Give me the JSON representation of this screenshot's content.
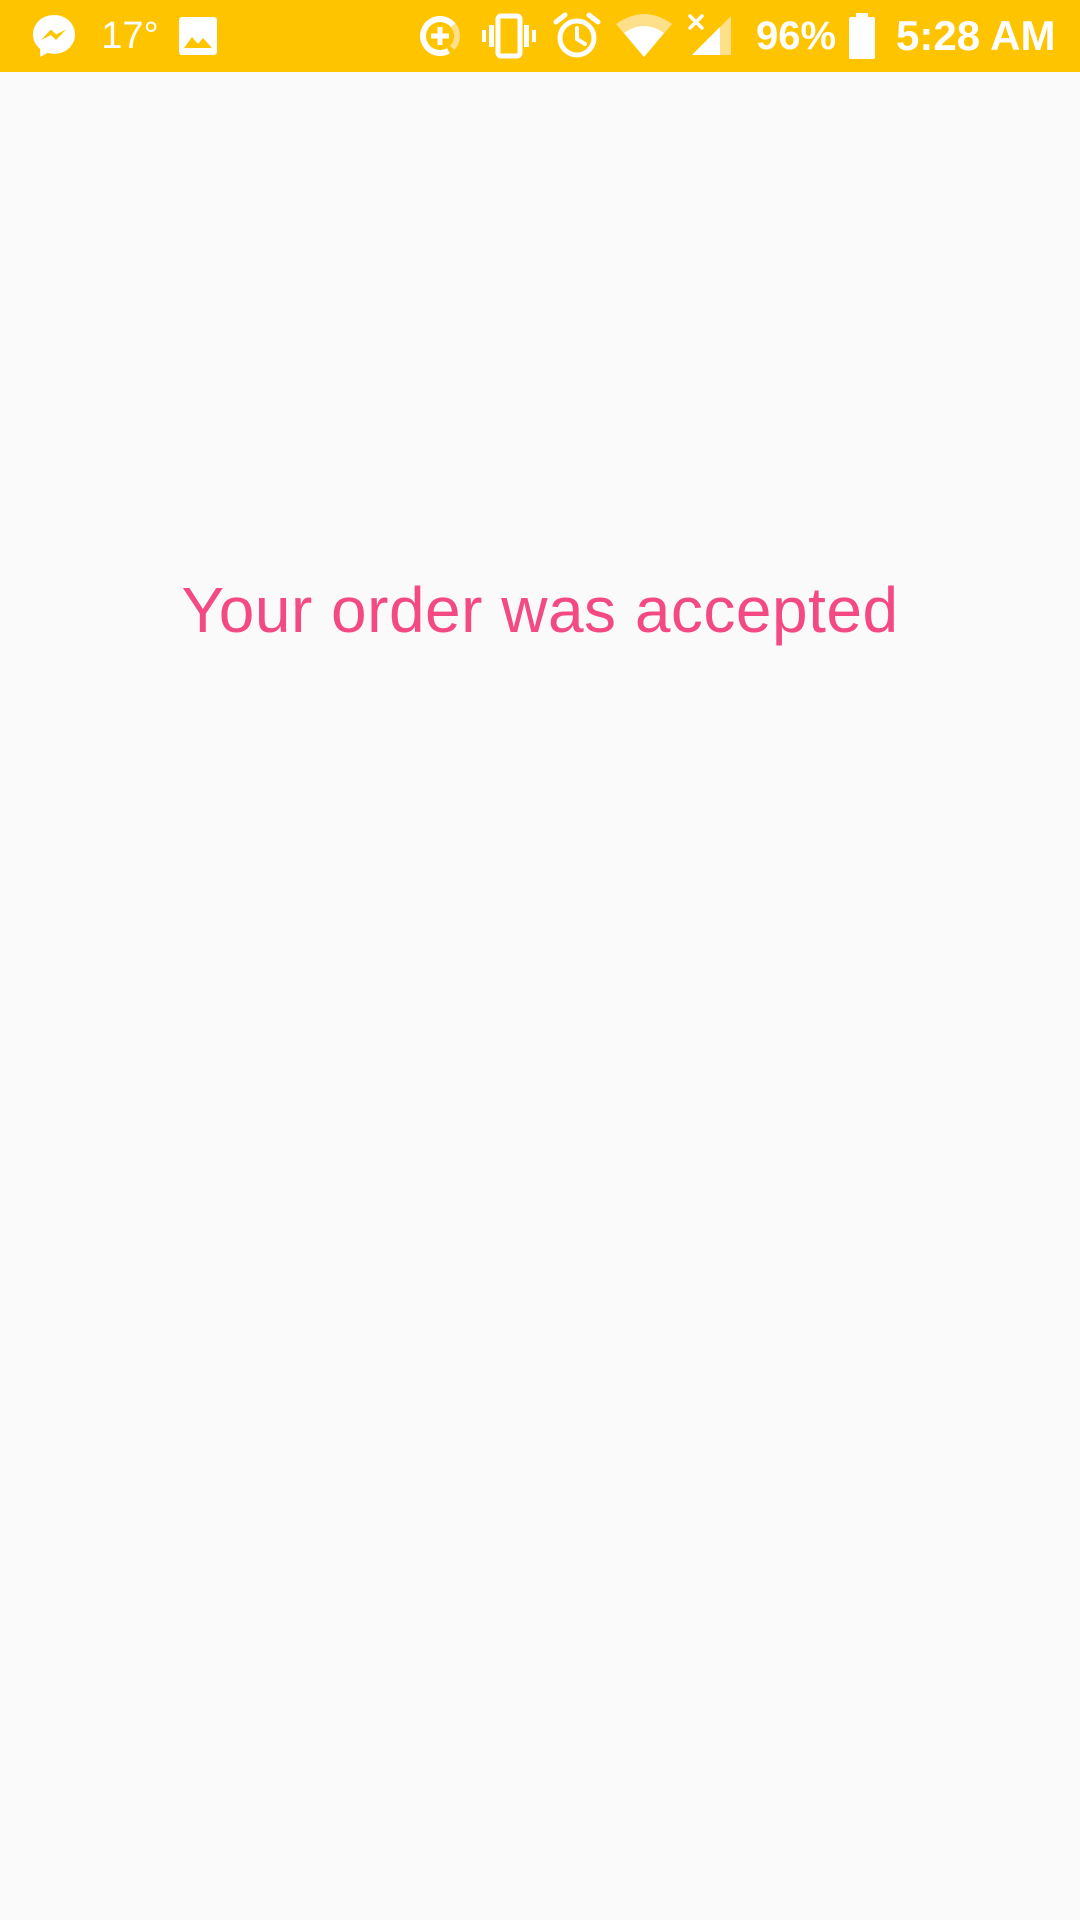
{
  "status_bar": {
    "background_color": "#ffc400",
    "icons_left": [
      "messenger-icon",
      "image-icon"
    ],
    "temperature": "17°",
    "icons_right": [
      "data-saver-icon",
      "vibrate-icon",
      "alarm-icon",
      "wifi-icon",
      "cellular-signal-icon",
      "battery-icon"
    ],
    "battery_percent": "96%",
    "time": "5:28 AM"
  },
  "content": {
    "message": "Your order was accepted",
    "message_color": "#f44a83",
    "background_color": "#fafafa"
  }
}
